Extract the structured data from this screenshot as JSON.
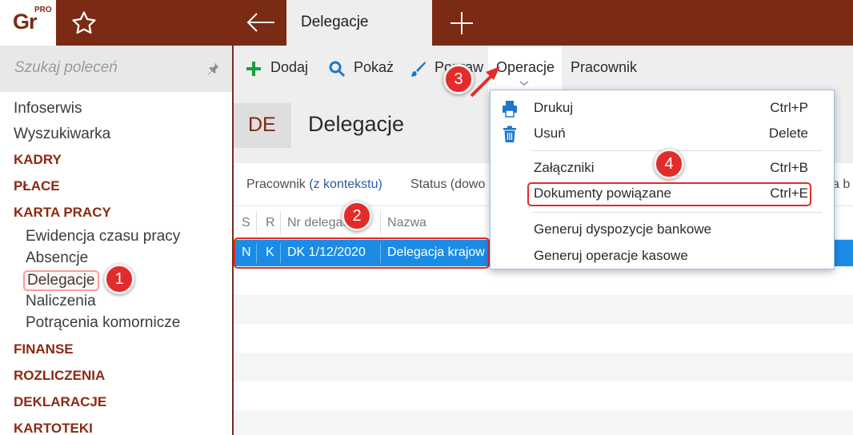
{
  "topbar": {
    "logo_text": "Gr",
    "logo_sup": "PRO",
    "tab_title": "Delegacje",
    "colors": {
      "brand": "#7b2a14",
      "accent": "#1b8ce6",
      "callout": "#e22b2b"
    }
  },
  "sidebar": {
    "search_placeholder": "Szukaj poleceń",
    "items": [
      {
        "label": "Infoserwis",
        "kind": "top"
      },
      {
        "label": "Wyszukiwarka",
        "kind": "top"
      },
      {
        "label": "KADRY",
        "kind": "section"
      },
      {
        "label": "PŁACE",
        "kind": "section"
      },
      {
        "label": "KARTA PRACY",
        "kind": "section"
      },
      {
        "label": "Ewidencja czasu pracy",
        "kind": "sub"
      },
      {
        "label": "Absencje",
        "kind": "sub"
      },
      {
        "label": "Delegacje",
        "kind": "sub",
        "selected": true
      },
      {
        "label": "Naliczenia",
        "kind": "sub"
      },
      {
        "label": "Potrącenia komornicze",
        "kind": "sub"
      },
      {
        "label": "FINANSE",
        "kind": "section"
      },
      {
        "label": "ROZLICZENIA",
        "kind": "section"
      },
      {
        "label": "DEKLARACJE",
        "kind": "section"
      },
      {
        "label": "KARTOTEKI",
        "kind": "section"
      }
    ]
  },
  "toolbar": {
    "add": "Dodaj",
    "show": "Pokaż",
    "edit": "Popraw",
    "operations": "Operacje",
    "employee": "Pracownik"
  },
  "page": {
    "badge": "DE",
    "title": "Delegacje"
  },
  "filters": {
    "employee_label": "Pracownik",
    "employee_value": "(z kontekstu)",
    "status_label": "Status (dowo",
    "right_fragment": "a b"
  },
  "grid": {
    "headers": [
      "S",
      "R",
      "Nr delegacji",
      "Nazwa"
    ],
    "selected_row": [
      "N",
      "K",
      "DK 1/12/2020",
      "Delegacja krajow"
    ]
  },
  "dropdown": {
    "items": [
      {
        "label": "Drukuj",
        "shortcut": "Ctrl+P",
        "icon": "printer-icon"
      },
      {
        "label": "Usuń",
        "shortcut": "Delete",
        "icon": "trash-icon"
      },
      {
        "label": "Załączniki",
        "shortcut": "Ctrl+B"
      },
      {
        "label": "Dokumenty powiązane",
        "shortcut": "Ctrl+E",
        "highlighted": true
      },
      {
        "label": "Generuj dyspozycje bankowe",
        "shortcut": ""
      },
      {
        "label": "Generuj operacje kasowe",
        "shortcut": ""
      }
    ]
  },
  "callouts": [
    "1",
    "2",
    "3",
    "4"
  ]
}
